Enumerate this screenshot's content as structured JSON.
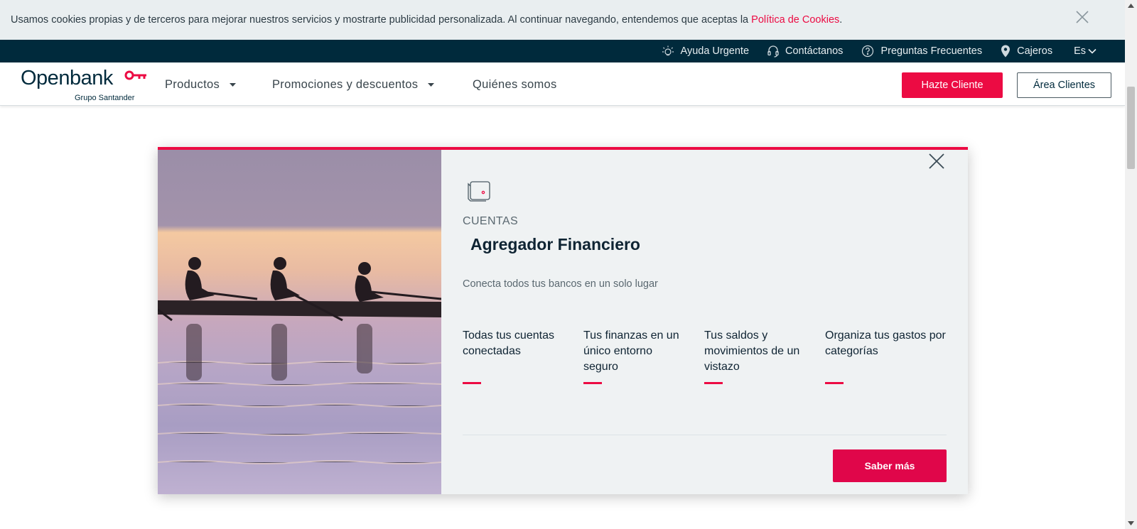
{
  "cookie_banner": {
    "text": "Usamos cookies propias y de terceros para mejorar nuestros servicios y mostrarte publicidad personalizada. Al continuar navegando, entendemos que aceptas la ",
    "link_text": "Política de Cookies",
    "suffix": "."
  },
  "utility_nav": {
    "items": [
      {
        "label": "Ayuda Urgente",
        "icon": "lightbulb-icon"
      },
      {
        "label": "Contáctanos",
        "icon": "headset-icon"
      },
      {
        "label": "Preguntas Frecuentes",
        "icon": "question-icon"
      },
      {
        "label": "Cajeros",
        "icon": "location-pin-icon"
      }
    ],
    "language": "Es"
  },
  "header": {
    "logo_text": "Openbank",
    "logo_subtext": "Grupo Santander",
    "nav": [
      {
        "label": "Productos"
      },
      {
        "label": "Promociones y descuentos"
      },
      {
        "label": "Quiénes somos"
      }
    ],
    "primary_button": "Hazte Cliente",
    "secondary_button": "Área Clientes"
  },
  "modal": {
    "category": "CUENTAS",
    "title": "Agregador Financiero",
    "subtitle": "Conecta todos tus bancos en un solo lugar",
    "features": [
      {
        "text": "Todas tus cuentas conectadas"
      },
      {
        "text": "Tus finanzas en un único entorno seguro"
      },
      {
        "text": "Tus saldos y movimientos de un vistazo"
      },
      {
        "text": "Organiza tus gastos por categorías"
      }
    ],
    "cta": "Saber más"
  },
  "colors": {
    "brand_red": "#ec0b43",
    "navy": "#002a3c"
  }
}
